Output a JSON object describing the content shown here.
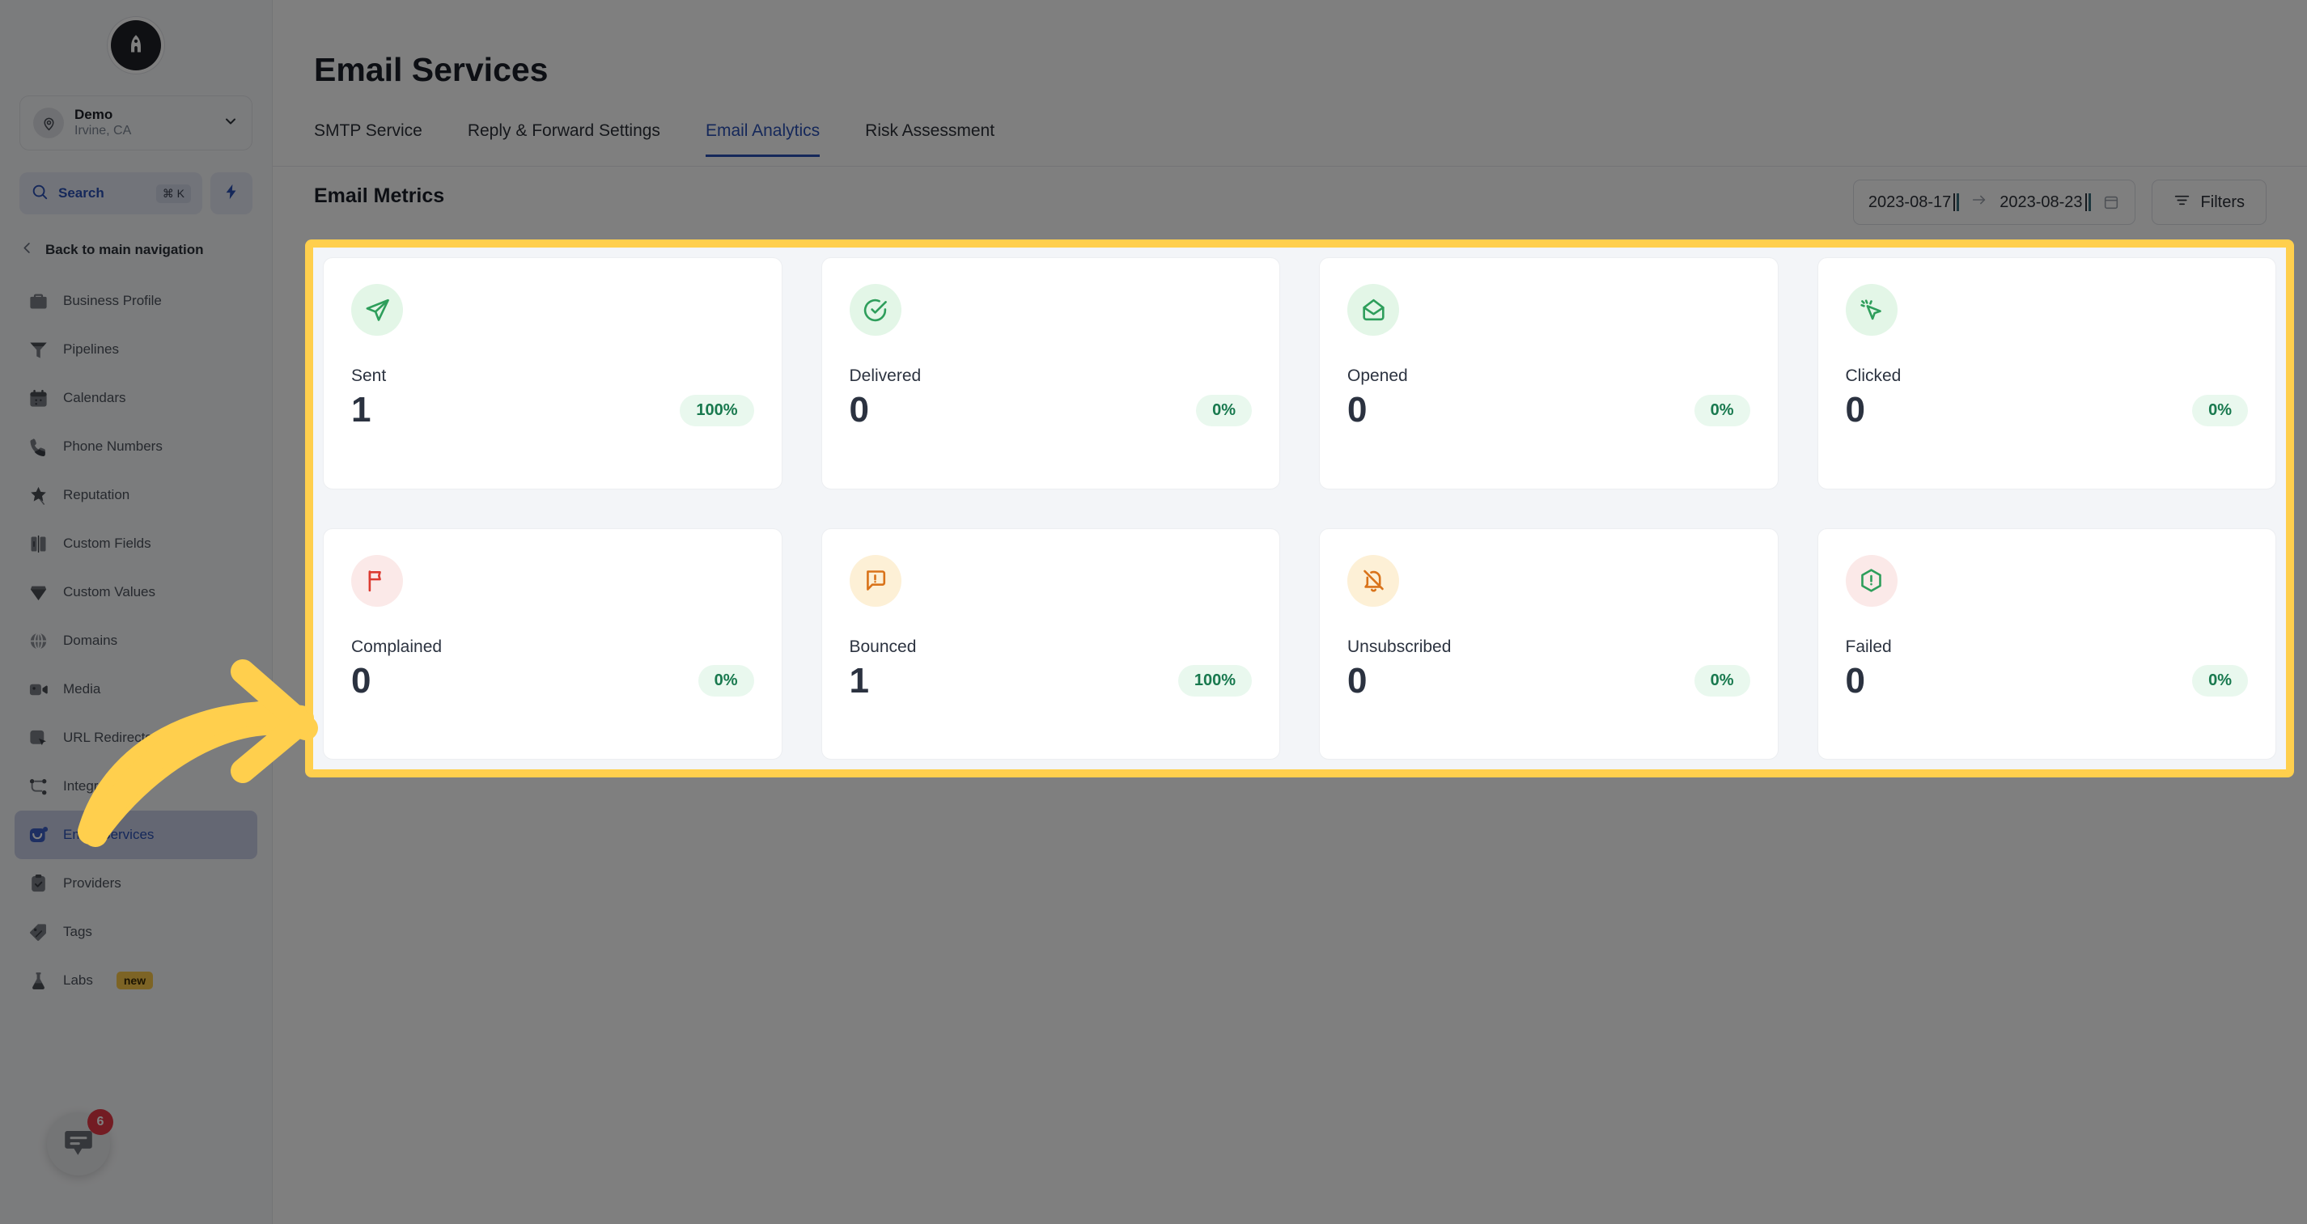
{
  "sidebar": {
    "logo_icon": "rocket-logo-icon",
    "location": {
      "name": "Demo",
      "sublabel": "Irvine, CA",
      "avatar_icon": "map-pin-icon",
      "chevron_icon": "chevron-down-icon"
    },
    "search": {
      "label": "Search",
      "shortcut": "⌘ K",
      "icon": "search-icon"
    },
    "quick_action_icon": "lightning-bolt-icon",
    "back_nav": {
      "label": "Back to main navigation",
      "icon": "chevron-left-icon"
    },
    "items": [
      {
        "label": "Business Profile",
        "icon": "briefcase-icon",
        "active": false
      },
      {
        "label": "Pipelines",
        "icon": "funnel-icon",
        "active": false
      },
      {
        "label": "Calendars",
        "icon": "calendar-icon",
        "active": false
      },
      {
        "label": "Phone Numbers",
        "icon": "phone-icon",
        "active": false
      },
      {
        "label": "Reputation",
        "icon": "star-icon",
        "active": false
      },
      {
        "label": "Custom Fields",
        "icon": "columns-icon",
        "active": false
      },
      {
        "label": "Custom Values",
        "icon": "diamond-icon",
        "active": false
      },
      {
        "label": "Domains",
        "icon": "globe-icon",
        "active": false
      },
      {
        "label": "Media",
        "icon": "video-camera-icon",
        "active": false
      },
      {
        "label": "URL Redirects",
        "icon": "cursor-click-icon",
        "active": false
      },
      {
        "label": "Integrations",
        "icon": "nodes-icon",
        "active": false
      },
      {
        "label": "Email Services",
        "icon": "email-smile-icon",
        "active": true
      },
      {
        "label": "Providers",
        "icon": "clipboard-check-icon",
        "active": false
      },
      {
        "label": "Tags",
        "icon": "tag-icon",
        "active": false
      },
      {
        "label": "Labs",
        "icon": "flask-icon",
        "active": false,
        "badge": "new"
      }
    ],
    "chat": {
      "icon": "chat-bubble-icon",
      "badge": "6"
    }
  },
  "header": {
    "title": "Email Services",
    "tabs": [
      {
        "label": "SMTP Service",
        "active": false
      },
      {
        "label": "Reply & Forward Settings",
        "active": false
      },
      {
        "label": "Email Analytics",
        "active": true
      },
      {
        "label": "Risk Assessment",
        "active": false
      }
    ]
  },
  "toolbar": {
    "section_title": "Email Metrics",
    "date_start": "2023-08-17",
    "date_end": "2023-08-23",
    "date_separator_icon": "arrow-right-icon",
    "calendar_icon": "calendar-icon",
    "filters_label": "Filters",
    "filters_icon": "filter-lines-icon"
  },
  "metrics": [
    {
      "label": "Sent",
      "value": "1",
      "percent": "100%",
      "icon": "paper-plane-icon",
      "tone": "green"
    },
    {
      "label": "Delivered",
      "value": "0",
      "percent": "0%",
      "icon": "check-circle-icon",
      "tone": "green"
    },
    {
      "label": "Opened",
      "value": "0",
      "percent": "0%",
      "icon": "open-envelope-icon",
      "tone": "green"
    },
    {
      "label": "Clicked",
      "value": "0",
      "percent": "0%",
      "icon": "cursor-click-icon",
      "tone": "green"
    },
    {
      "label": "Complained",
      "value": "0",
      "percent": "0%",
      "icon": "flag-icon",
      "tone": "red"
    },
    {
      "label": "Bounced",
      "value": "1",
      "percent": "100%",
      "icon": "message-alert-icon",
      "tone": "orange"
    },
    {
      "label": "Unsubscribed",
      "value": "0",
      "percent": "0%",
      "icon": "bell-off-icon",
      "tone": "orange"
    },
    {
      "label": "Failed",
      "value": "0",
      "percent": "0%",
      "icon": "hexagon-alert-icon",
      "tone": "red"
    }
  ],
  "annotation": {
    "highlight_color": "#ffcf4d",
    "arrow_color": "#ffcf4d",
    "arrow_icon": "curved-arrow-right-icon"
  },
  "colors": {
    "accent": "#2b50b4",
    "green": "#2e9e5b",
    "green_bg": "#e3f6e7",
    "red": "#dc3a31",
    "red_bg": "#fbe9e8",
    "orange": "#d9731a",
    "orange_bg": "#fdf0d6",
    "pill_bg": "#e9f8ee",
    "pill_text": "#18794e"
  }
}
